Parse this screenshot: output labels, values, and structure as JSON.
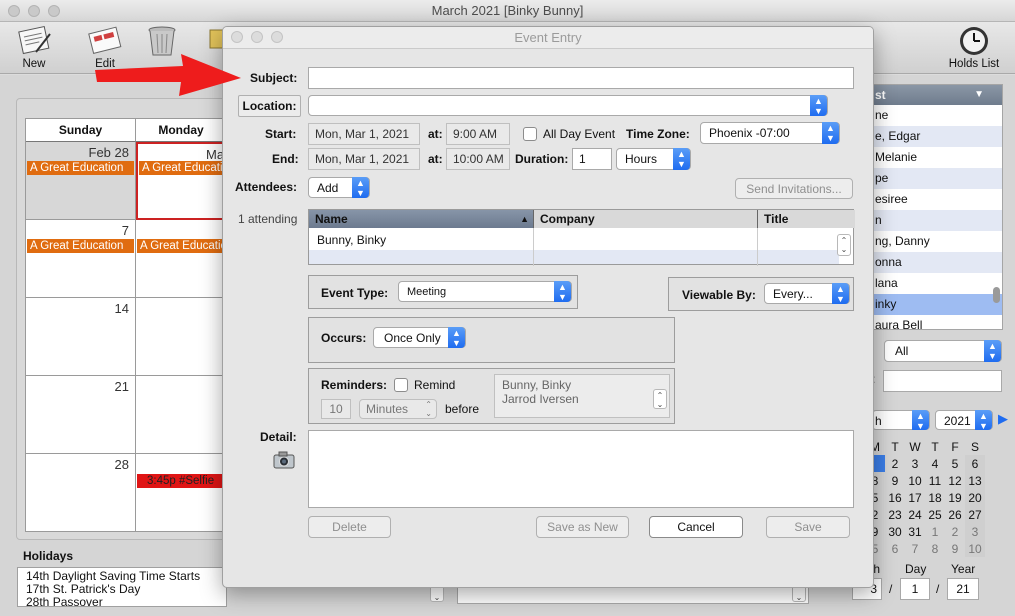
{
  "window": {
    "title": "March 2021  [Binky Bunny]"
  },
  "toolbar": {
    "new_label": "New",
    "edit_label": "Edit",
    "holds_list_label": "Holds List"
  },
  "calendar": {
    "col_sunday": "Sunday",
    "col_monday": "Monday",
    "mon_partial": "Ma",
    "feb28": "Feb 28",
    "d7": "7",
    "d14": "14",
    "d21": "21",
    "d28": "28",
    "ev_sun1": "A Great Education",
    "ev_mon1": "A Great Educatio",
    "ev_sun2": "A Great Education",
    "ev_mon2": "A Great Educatio",
    "ev_selfie": "3:45p #Selfie"
  },
  "holidays": {
    "title": "Holidays",
    "items": [
      "14th Daylight Saving Time Starts",
      "17th St. Patrick's Day",
      "28th Passover"
    ]
  },
  "right_panel": {
    "list_header": "st",
    "rows": [
      "ne",
      "e, Edgar",
      "Melanie",
      "pe",
      "esiree",
      "n",
      "ng, Danny",
      "onna",
      "lana",
      "inky",
      "aura Bell"
    ],
    "filter_value": "All",
    "search_label": ":",
    "month_partial": "h",
    "year_value": "2021",
    "minical_header": [
      "M",
      "T",
      "W",
      "T",
      "F",
      "S"
    ],
    "minical_rows": [
      [
        "1",
        "2",
        "3",
        "4",
        "5",
        "6"
      ],
      [
        "8",
        "9",
        "10",
        "11",
        "12",
        "13"
      ],
      [
        "5",
        "16",
        "17",
        "18",
        "19",
        "20"
      ],
      [
        "2",
        "23",
        "24",
        "25",
        "26",
        "27"
      ],
      [
        "9",
        "30",
        "31",
        "1",
        "2",
        "3"
      ],
      [
        "5",
        "6",
        "7",
        "8",
        "9",
        "10"
      ]
    ],
    "mdy_label_month": "th",
    "mdy_label_day": "Day",
    "mdy_label_year": "Year",
    "mdy_month": "3",
    "mdy_day": "1",
    "mdy_year": "21",
    "slash": "/"
  },
  "dialog": {
    "title": "Event Entry",
    "subject_label": "Subject:",
    "subject_value": "",
    "location_label": "Location:",
    "location_value": "",
    "start_label": "Start:",
    "start_date": "Mon, Mar 1, 2021",
    "at_label": "at:",
    "start_time": "9:00 AM",
    "all_day_label": "All Day Event",
    "timezone_label": "Time Zone:",
    "timezone_value": "Phoenix -07:00",
    "end_label": "End:",
    "end_date": "Mon, Mar 1, 2021",
    "end_time": "10:00 AM",
    "duration_label": "Duration:",
    "duration_value": "1",
    "duration_unit": "Hours",
    "attendees_label": "Attendees:",
    "add_label": "Add",
    "send_invitations_label": "Send Invitations...",
    "attending_count": "1 attending",
    "table_headers": [
      "Name",
      "Company",
      "Title"
    ],
    "attendee_name": "Bunny, Binky",
    "event_type_label": "Event Type:",
    "event_type_value": "Meeting",
    "viewable_by_label": "Viewable By:",
    "viewable_by_value": "Every...",
    "occurs_label": "Occurs:",
    "occurs_value": "Once Only",
    "reminders_label": "Reminders:",
    "remind_label": "Remind",
    "reminder_count": "10",
    "reminder_unit": "Minutes",
    "before_label": "before",
    "remind_people": [
      "Bunny, Binky",
      "Jarrod Iversen"
    ],
    "detail_label": "Detail:",
    "detail_value": "",
    "delete_label": "Delete",
    "save_as_new_label": "Save as New",
    "cancel_label": "Cancel",
    "save_label": "Save"
  },
  "colors": {
    "event_orange": "#e06c10",
    "event_red": "#e01515",
    "accent_blue": "#1f6cf0",
    "arrow_red": "#ee1c1c"
  }
}
